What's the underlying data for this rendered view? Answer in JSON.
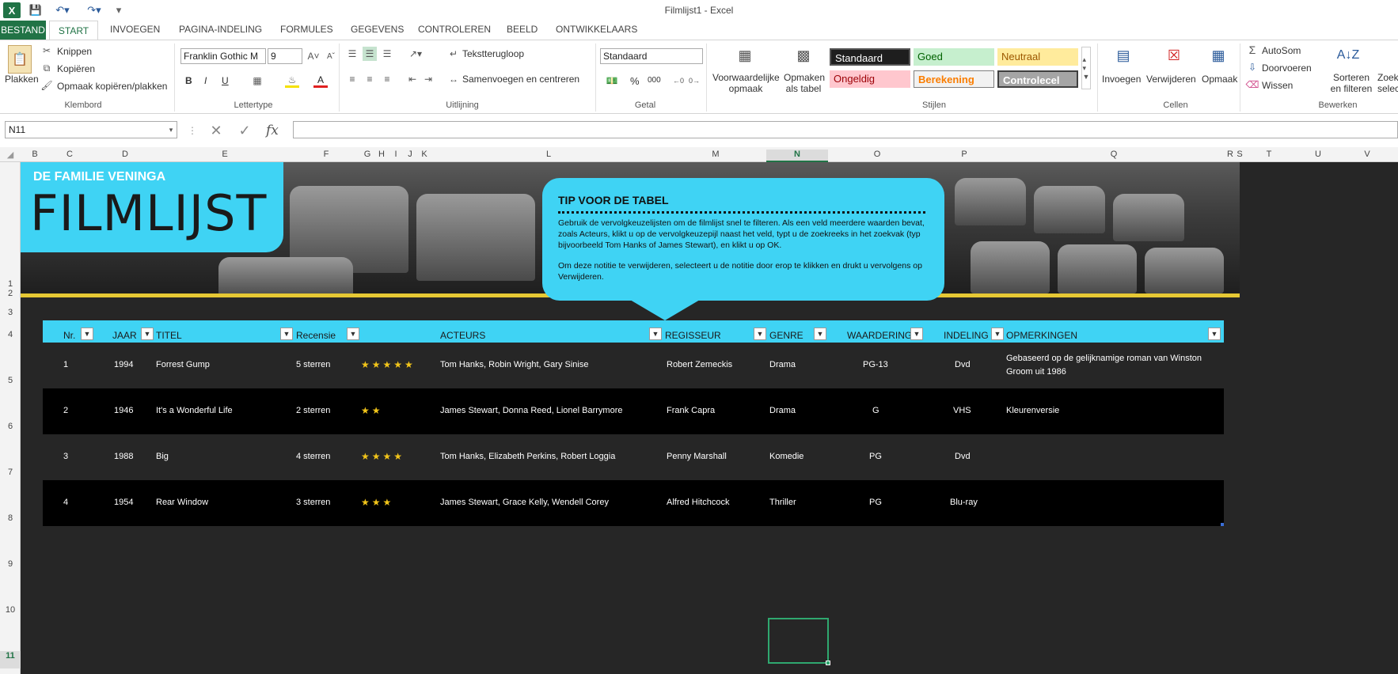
{
  "window": {
    "title": "Filmlijst1 - Excel"
  },
  "tabs": {
    "file": "BESTAND",
    "start": "START",
    "items": [
      "INVOEGEN",
      "PAGINA-INDELING",
      "FORMULES",
      "GEGEVENS",
      "CONTROLEREN",
      "BEELD",
      "ONTWIKKELAARS"
    ]
  },
  "ribbon": {
    "clipboard": {
      "label": "Klembord",
      "paste": "Plakken",
      "cut": "Knippen",
      "copy": "Kopiëren",
      "format_painter": "Opmaak kopiëren/plakken"
    },
    "font": {
      "label": "Lettertype",
      "name": "Franklin Gothic M",
      "size": "9",
      "bold": "B",
      "italic": "I",
      "underline": "U"
    },
    "alignment": {
      "label": "Uitlijning",
      "wrap": "Tekstterugloop",
      "merge": "Samenvoegen en centreren"
    },
    "number": {
      "label": "Getal",
      "format": "Standaard",
      "percent": "%",
      "thousands": "000"
    },
    "styles": {
      "label": "Stijlen",
      "conditional": "Voorwaardelijke opmaak",
      "format_table": "Opmaken als tabel",
      "cells": [
        {
          "name": "Standaard",
          "bg": "#1e1e1e",
          "fg": "#ffffff"
        },
        {
          "name": "Goed",
          "bg": "#c6efce",
          "fg": "#006100"
        },
        {
          "name": "Neutraal",
          "bg": "#ffeb9c",
          "fg": "#9c5700"
        },
        {
          "name": "Ongeldig",
          "bg": "#ffc7ce",
          "fg": "#9c0006"
        },
        {
          "name": "Berekening",
          "bg": "#f2f2f2",
          "fg": "#fa7d00"
        },
        {
          "name": "Controlecel",
          "bg": "#a5a5a5",
          "fg": "#ffffff"
        }
      ]
    },
    "cells": {
      "label": "Cellen",
      "insert": "Invoegen",
      "delete": "Verwijderen",
      "format": "Opmaak"
    },
    "editing": {
      "label": "Bewerken",
      "autosum": "AutoSom",
      "fill": "Doorvoeren",
      "clear": "Wissen",
      "sort": "Sorteren en filteren",
      "find": "Zoek selec"
    }
  },
  "formula_bar": {
    "name_box": "N11",
    "fx": "fx",
    "value": ""
  },
  "columns": [
    "B",
    "C",
    "D",
    "E",
    "F",
    "G",
    "H",
    "I",
    "J",
    "K",
    "L",
    "M",
    "N",
    "O",
    "P",
    "Q",
    "R",
    "S",
    "T",
    "U",
    "V"
  ],
  "rows": [
    "1",
    "2",
    "3",
    "4",
    "5",
    "6",
    "7",
    "8",
    "9",
    "10",
    "11"
  ],
  "sheet": {
    "family": "DE FAMILIE VENINGA",
    "title": "FILMLIJST",
    "tip": {
      "heading": "TIP VOOR DE TABEL",
      "p1": "Gebruik de vervolgkeuzelijsten om de filmlijst snel te filteren. Als een veld meerdere waarden bevat, zoals Acteurs, klikt u op de vervolgkeuzepijl naast het veld, typt u de zoekreeks in het zoekvak (typ bijvoorbeeld Tom Hanks of James Stewart), en klikt u op OK.",
      "p2": "Om deze notitie te verwijderen, selecteert u de notitie door erop te klikken en drukt u vervolgens op Verwijderen."
    },
    "headers": {
      "nr": "Nr.",
      "jaar": "JAAR",
      "titel": "TITEL",
      "recensie": "Recensie",
      "acteurs": "ACTEURS",
      "regisseur": "REGISSEUR",
      "genre": "GENRE",
      "waardering": "WAARDERING",
      "indeling": "INDELING",
      "opmerkingen": "OPMERKINGEN"
    },
    "movies": [
      {
        "nr": "1",
        "jaar": "1994",
        "titel": "Forrest Gump",
        "recensie": "5 sterren",
        "stars": 5,
        "acteurs": "Tom Hanks, Robin Wright, Gary Sinise",
        "regisseur": "Robert Zemeckis",
        "genre": "Drama",
        "waardering": "PG-13",
        "indeling": "Dvd",
        "opm1": "Gebaseerd op de gelijknamige roman van Winston",
        "opm2": "Groom uit 1986"
      },
      {
        "nr": "2",
        "jaar": "1946",
        "titel": "It's a Wonderful Life",
        "recensie": "2 sterren",
        "stars": 2,
        "acteurs": "James Stewart, Donna Reed, Lionel Barrymore",
        "regisseur": "Frank Capra",
        "genre": "Drama",
        "waardering": "G",
        "indeling": "VHS",
        "opm1": "Kleurenversie",
        "opm2": ""
      },
      {
        "nr": "3",
        "jaar": "1988",
        "titel": "Big",
        "recensie": "4 sterren",
        "stars": 4,
        "acteurs": "Tom Hanks, Elizabeth Perkins, Robert Loggia",
        "regisseur": "Penny Marshall",
        "genre": "Komedie",
        "waardering": "PG",
        "indeling": "Dvd",
        "opm1": "",
        "opm2": ""
      },
      {
        "nr": "4",
        "jaar": "1954",
        "titel": "Rear Window",
        "recensie": "3 sterren",
        "stars": 3,
        "acteurs": "James Stewart, Grace Kelly, Wendell Corey",
        "regisseur": "Alfred Hitchcock",
        "genre": "Thriller",
        "waardering": "PG",
        "indeling": "Blu-ray",
        "opm1": "",
        "opm2": ""
      }
    ]
  },
  "colors": {
    "accent": "#3fd3f4",
    "excel_green": "#217346",
    "row_dark": "#000000",
    "row_mid": "#262626",
    "banner_line": "#e6c834"
  }
}
